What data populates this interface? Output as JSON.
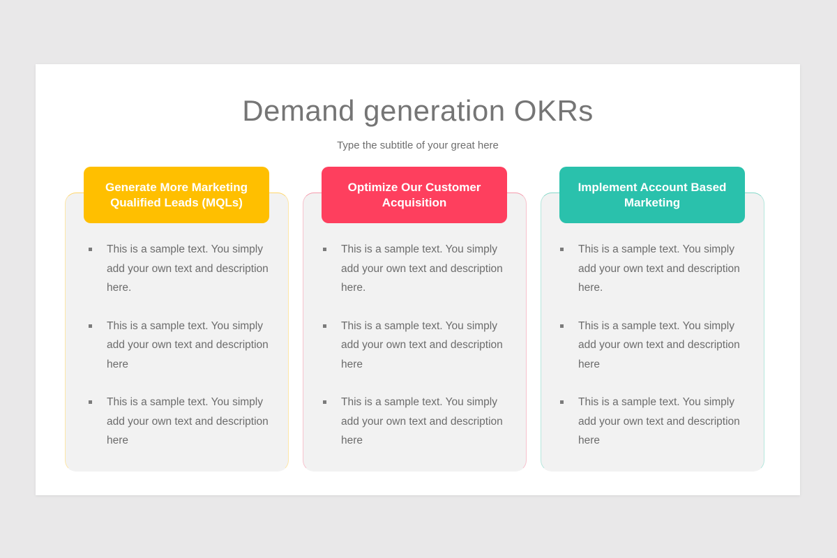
{
  "slide": {
    "title": "Demand generation OKRs",
    "subtitle": "Type the subtitle of your great here"
  },
  "columns": [
    {
      "header": "Generate More Marketing Qualified Leads (MQLs)",
      "color": "#ffbf00",
      "bullets": [
        "This is a sample text. You simply add your own text and description here.",
        "This is a sample text. You simply add your own text and description here",
        "This is a sample text. You simply add your own text and description here"
      ]
    },
    {
      "header": "Optimize Our Customer Acquisition",
      "color": "#fe3f5e",
      "bullets": [
        "This is a sample text. You simply add your own text and description here.",
        "This is a sample text. You simply add your own text and description here",
        "This is a sample text. You simply add your own text and description here"
      ]
    },
    {
      "header": "Implement Account Based Marketing",
      "color": "#2ac1ac",
      "bullets": [
        "This is a sample text. You simply add your own text and description here.",
        "This is a sample text. You simply add your own text and description here",
        "This is a sample text. You simply add your own text and description here"
      ]
    }
  ]
}
